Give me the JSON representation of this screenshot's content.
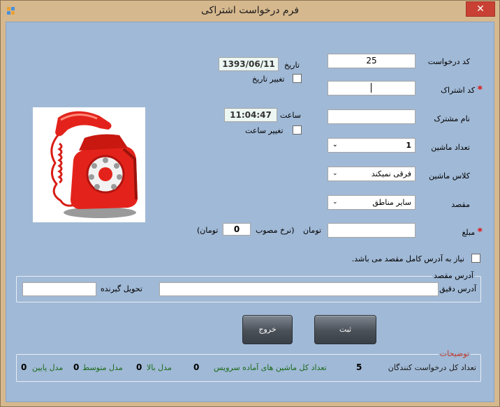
{
  "window": {
    "title": "فرم درخواست اشتراکی",
    "close_glyph": "✕"
  },
  "form": {
    "request_code": {
      "label": "کد درخواست",
      "value": "25"
    },
    "subscription_code": {
      "label": "کد اشتراک",
      "value": ""
    },
    "subscriber_name": {
      "label": "نام مشترک",
      "value": ""
    },
    "car_count": {
      "label": "تعداد ماشین",
      "value": "1"
    },
    "car_class": {
      "label": "کلاس ماشین",
      "value": "فرقی نمیکند"
    },
    "destination": {
      "label": "مقصد",
      "value": "سایر مناطق"
    },
    "amount": {
      "label": "مبلغ",
      "value": "",
      "unit": "تومان"
    },
    "rate": {
      "prefix": "(نرخ مصوب",
      "value": "0",
      "suffix": "تومان)"
    },
    "date": {
      "label": "تاریخ",
      "value": "1393/06/11",
      "change_label": "تغییر تاریخ"
    },
    "time": {
      "label": "ساعت",
      "value": "11:04:47",
      "change_label": "تغییر ساعت"
    },
    "required_star": "*",
    "combo_arrow": "⌄"
  },
  "full_address_check": {
    "label": "نیاز به آدرس کامل مقصد می باشد."
  },
  "address_group": {
    "title": "آدرس مقصد",
    "exact_label": "آدرس دقیق",
    "exact_value": "",
    "receiver_label": "تحویل گیرنده",
    "receiver_value": ""
  },
  "buttons": {
    "save": "ثبت",
    "exit": "خروج"
  },
  "stats": {
    "title": "توضیحات",
    "total_requests_label": "تعداد کل درخواست کنندگان",
    "total_requests": "5",
    "ready_cars_label": "تعداد کل ماشین های آماده سرویس",
    "ready_cars": "0",
    "high_model_label": "مدل بالا",
    "high_model": "0",
    "mid_model_label": "مدل متوسط",
    "mid_model": "0",
    "low_model_label": "مدل پایین",
    "low_model": "0"
  },
  "colors": {
    "frame": "#d6b88e",
    "client": "#a0b9d6",
    "close": "#c94134",
    "required": "#e01010",
    "stats_title": "#c0392b",
    "stats_label": "#1a6a1a"
  },
  "icons": {
    "app": "form-app-icon",
    "illustration": "red-rotary-telephone-icon"
  }
}
